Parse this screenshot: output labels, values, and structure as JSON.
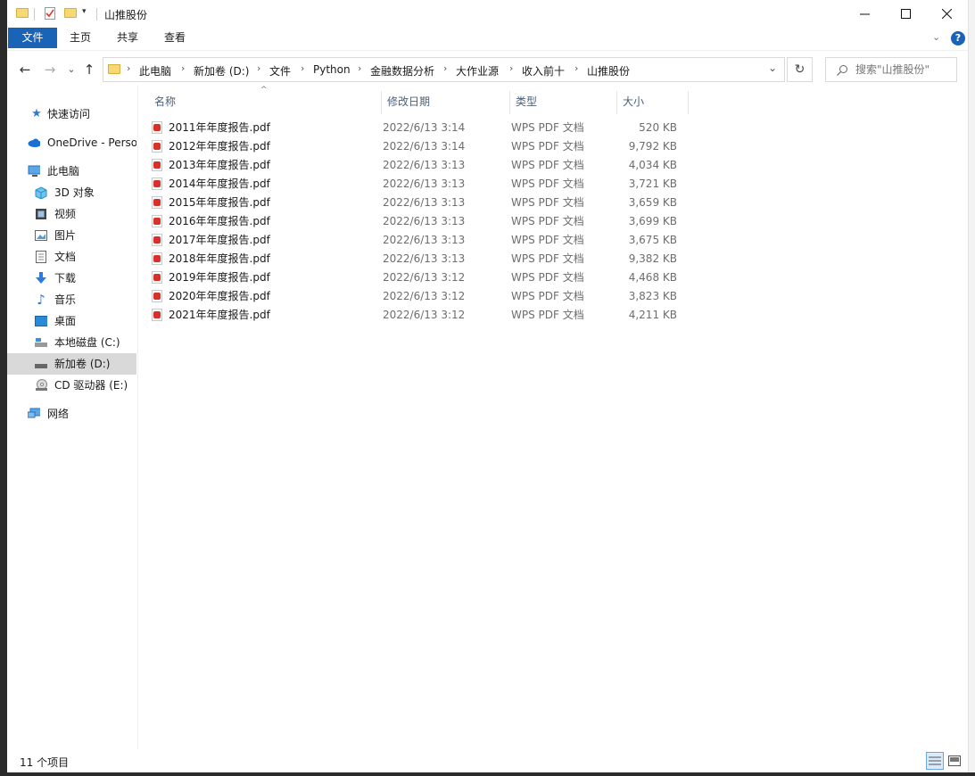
{
  "window": {
    "title": "山推股份"
  },
  "ribbon": {
    "tabs": [
      "文件",
      "主页",
      "共享",
      "查看"
    ]
  },
  "nav": {
    "back": "←",
    "forward": "→",
    "recent": "⌄",
    "up": "↑",
    "breadcrumbs": [
      "此电脑",
      "新加卷 (D:)",
      "文件",
      "Python",
      "金融数据分析",
      "大作业源",
      "收入前十",
      "山推股份"
    ],
    "search_placeholder": "搜索\"山推股份\""
  },
  "sidebar": {
    "items": [
      {
        "label": "快速访问",
        "icon": "star-icon"
      },
      {
        "label": "OneDrive - Perso",
        "icon": "cloud-icon"
      },
      {
        "label": "此电脑",
        "icon": "computer-icon"
      },
      {
        "label": "3D 对象",
        "icon": "cube-icon"
      },
      {
        "label": "视频",
        "icon": "video-icon"
      },
      {
        "label": "图片",
        "icon": "picture-icon"
      },
      {
        "label": "文档",
        "icon": "document-icon"
      },
      {
        "label": "下载",
        "icon": "download-icon"
      },
      {
        "label": "音乐",
        "icon": "music-icon"
      },
      {
        "label": "桌面",
        "icon": "desktop-icon"
      },
      {
        "label": "本地磁盘 (C:)",
        "icon": "drive-icon"
      },
      {
        "label": "新加卷 (D:)",
        "icon": "drive-icon"
      },
      {
        "label": "CD 驱动器 (E:)",
        "icon": "cd-icon"
      },
      {
        "label": "网络",
        "icon": "network-icon"
      }
    ]
  },
  "columns": {
    "name": "名称",
    "date": "修改日期",
    "type": "类型",
    "size": "大小"
  },
  "files": [
    {
      "name": "2011年年度报告.pdf",
      "date": "2022/6/13 3:14",
      "type": "WPS PDF 文档",
      "size": "520 KB"
    },
    {
      "name": "2012年年度报告.pdf",
      "date": "2022/6/13 3:14",
      "type": "WPS PDF 文档",
      "size": "9,792 KB"
    },
    {
      "name": "2013年年度报告.pdf",
      "date": "2022/6/13 3:13",
      "type": "WPS PDF 文档",
      "size": "4,034 KB"
    },
    {
      "name": "2014年年度报告.pdf",
      "date": "2022/6/13 3:13",
      "type": "WPS PDF 文档",
      "size": "3,721 KB"
    },
    {
      "name": "2015年年度报告.pdf",
      "date": "2022/6/13 3:13",
      "type": "WPS PDF 文档",
      "size": "3,659 KB"
    },
    {
      "name": "2016年年度报告.pdf",
      "date": "2022/6/13 3:13",
      "type": "WPS PDF 文档",
      "size": "3,699 KB"
    },
    {
      "name": "2017年年度报告.pdf",
      "date": "2022/6/13 3:13",
      "type": "WPS PDF 文档",
      "size": "3,675 KB"
    },
    {
      "name": "2018年年度报告.pdf",
      "date": "2022/6/13 3:13",
      "type": "WPS PDF 文档",
      "size": "9,382 KB"
    },
    {
      "name": "2019年年度报告.pdf",
      "date": "2022/6/13 3:12",
      "type": "WPS PDF 文档",
      "size": "4,468 KB"
    },
    {
      "name": "2020年年度报告.pdf",
      "date": "2022/6/13 3:12",
      "type": "WPS PDF 文档",
      "size": "3,823 KB"
    },
    {
      "name": "2021年年度报告.pdf",
      "date": "2022/6/13 3:12",
      "type": "WPS PDF 文档",
      "size": "4,211 KB"
    }
  ],
  "status": {
    "count": "11 个项目"
  },
  "colors": {
    "accent": "#1a64b8",
    "selected": "#d9d9d9",
    "header_text": "#4c6079",
    "pdf_red": "#d9302a"
  }
}
